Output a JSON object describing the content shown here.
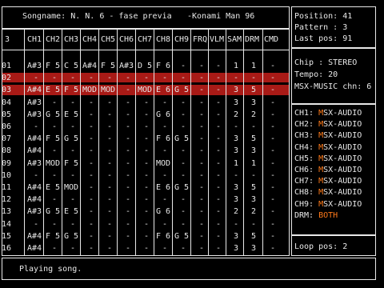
{
  "header": {
    "title": "Songname: N. N. 6 - fase previa",
    "author": "-Konami Man 96"
  },
  "info": {
    "position": "Position: 41",
    "pattern": "Pattern : 3",
    "last_pos": "Last pos: 91"
  },
  "columns": {
    "pattern_no": "3",
    "labels": [
      "CH1",
      "CH2",
      "CH3",
      "CH4",
      "CH5",
      "CH6",
      "CH7",
      "CH8",
      "CH9",
      "FRQ",
      "VLM",
      "SAM",
      "DRM",
      "CMD"
    ]
  },
  "rows": [
    {
      "n": "01",
      "c": [
        "A#3",
        "F 5",
        "C 5",
        "A#4",
        "F 5",
        "A#3",
        "D 5",
        "F 6",
        "-",
        "-",
        "-",
        "1",
        "1",
        "-"
      ]
    },
    {
      "n": "02",
      "c": [
        "-",
        "-",
        "-",
        "-",
        "-",
        "-",
        "-",
        "-",
        "-",
        "-",
        "-",
        "-",
        "-",
        "-"
      ]
    },
    {
      "n": "03",
      "c": [
        "A#4",
        "E 5",
        "F 5",
        "MOD",
        "MOD",
        "-",
        "MOD",
        "E 6",
        "G 5",
        "-",
        "-",
        "3",
        "5",
        "-"
      ]
    },
    {
      "n": "04",
      "c": [
        "A#3",
        "-",
        "-",
        "-",
        "-",
        "-",
        "-",
        "-",
        "-",
        "-",
        "-",
        "3",
        "3",
        "-"
      ]
    },
    {
      "n": "05",
      "c": [
        "A#3",
        "G 5",
        "E 5",
        "-",
        "-",
        "-",
        "-",
        "G 6",
        "-",
        "-",
        "-",
        "2",
        "2",
        "-"
      ]
    },
    {
      "n": "06",
      "c": [
        "-",
        "-",
        "-",
        "-",
        "-",
        "-",
        "-",
        "-",
        "-",
        "-",
        "-",
        "-",
        "-",
        "-"
      ]
    },
    {
      "n": "07",
      "c": [
        "A#4",
        "F 5",
        "G 5",
        "-",
        "-",
        "-",
        "-",
        "F 6",
        "G 5",
        "-",
        "-",
        "3",
        "5",
        "-"
      ]
    },
    {
      "n": "08",
      "c": [
        "A#4",
        "-",
        "-",
        "-",
        "-",
        "-",
        "-",
        "-",
        "-",
        "-",
        "-",
        "3",
        "3",
        "-"
      ]
    },
    {
      "n": "09",
      "c": [
        "A#3",
        "MOD",
        "F 5",
        "-",
        "-",
        "-",
        "-",
        "MOD",
        "-",
        "-",
        "-",
        "1",
        "1",
        "-"
      ]
    },
    {
      "n": "10",
      "c": [
        "-",
        "-",
        "-",
        "-",
        "-",
        "-",
        "-",
        "-",
        "-",
        "-",
        "-",
        "-",
        "-",
        "-"
      ]
    },
    {
      "n": "11",
      "c": [
        "A#4",
        "E 5",
        "MOD",
        "-",
        "-",
        "-",
        "-",
        "E 6",
        "G 5",
        "-",
        "-",
        "3",
        "5",
        "-"
      ]
    },
    {
      "n": "12",
      "c": [
        "A#4",
        "-",
        "-",
        "-",
        "-",
        "-",
        "-",
        "-",
        "-",
        "-",
        "-",
        "3",
        "3",
        "-"
      ]
    },
    {
      "n": "13",
      "c": [
        "A#3",
        "G 5",
        "E 5",
        "-",
        "-",
        "-",
        "-",
        "G 6",
        "-",
        "-",
        "-",
        "2",
        "2",
        "-"
      ]
    },
    {
      "n": "14",
      "c": [
        "-",
        "-",
        "-",
        "-",
        "-",
        "-",
        "-",
        "-",
        "-",
        "-",
        "-",
        "-",
        "-",
        "-"
      ]
    },
    {
      "n": "15",
      "c": [
        "A#4",
        "F 5",
        "G 5",
        "-",
        "-",
        "-",
        "-",
        "F 6",
        "G 5",
        "-",
        "-",
        "3",
        "5",
        "-"
      ]
    },
    {
      "n": "16",
      "c": [
        "A#4",
        "-",
        "-",
        "-",
        "-",
        "-",
        "-",
        "-",
        "-",
        "-",
        "-",
        "3",
        "3",
        "-"
      ]
    }
  ],
  "chip": {
    "chip": "Chip : STEREO",
    "tempo": "Tempo: 20",
    "msx_music": "MSX-MUSIC chn: 6"
  },
  "channels": [
    {
      "ch": "CH1:",
      "m": "M",
      "src": "SX-AUDIO"
    },
    {
      "ch": "CH2:",
      "m": "M",
      "src": "SX-AUDIO"
    },
    {
      "ch": "CH3:",
      "m": "M",
      "src": "SX-AUDIO"
    },
    {
      "ch": "CH4:",
      "m": "M",
      "src": "SX-AUDIO"
    },
    {
      "ch": "CH5:",
      "m": "M",
      "src": "SX-AUDIO"
    },
    {
      "ch": "CH6:",
      "m": "M",
      "src": "SX-AUDIO"
    },
    {
      "ch": "CH7:",
      "m": "M",
      "src": "SX-AUDIO"
    },
    {
      "ch": "CH8:",
      "m": "M",
      "src": "SX-AUDIO"
    },
    {
      "ch": "CH9:",
      "m": "M",
      "src": "SX-AUDIO"
    }
  ],
  "drm": {
    "label": "DRM:",
    "value_a": "B",
    "value_b": "OTH"
  },
  "loop": "Loop pos: 2",
  "status": "Playing song.",
  "colors": {
    "highlight": "#a81a16",
    "accent": "#ff7a1a",
    "fg": "#e8e8e8",
    "bg": "#000000"
  }
}
